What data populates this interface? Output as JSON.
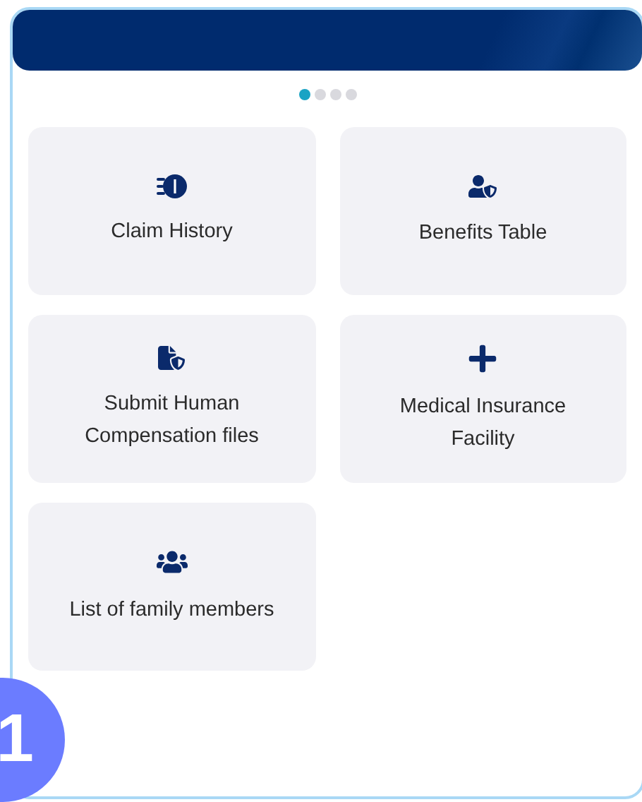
{
  "pager": {
    "dots": [
      {
        "selected": true
      },
      {
        "selected": false
      },
      {
        "selected": false
      },
      {
        "selected": false
      }
    ]
  },
  "tiles": [
    {
      "label": "Claim History",
      "kind": "money"
    },
    {
      "label": "Benefits Table",
      "kind": "user-shield"
    },
    {
      "label": "Submit Human Compensation files",
      "kind": "file-shield"
    },
    {
      "label": "Medical Insurance Facility",
      "kind": "plus"
    },
    {
      "label": "List of family members",
      "kind": "users"
    }
  ],
  "step_badge": "1"
}
